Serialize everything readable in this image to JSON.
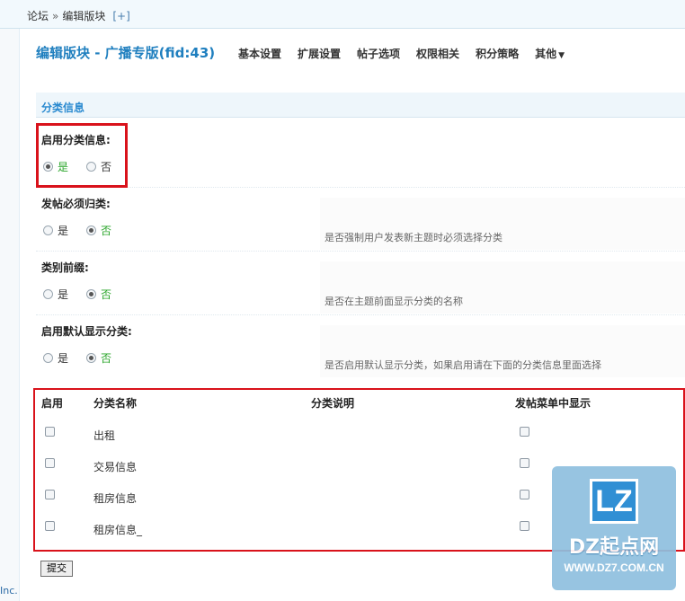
{
  "breadcrumb": {
    "items": [
      "论坛",
      "编辑版块"
    ],
    "separator": "»",
    "add_label": "[+]"
  },
  "header": {
    "title": "编辑版块 - 广播专版(fid:43)",
    "tabs": [
      "基本设置",
      "扩展设置",
      "帖子选项",
      "权限相关",
      "积分策略",
      "其他"
    ]
  },
  "section": {
    "title": "分类信息"
  },
  "settings": [
    {
      "label": "启用分类信息:",
      "options": [
        "是",
        "否"
      ],
      "selected": "是",
      "tip": ""
    },
    {
      "label": "发帖必须归类:",
      "options": [
        "是",
        "否"
      ],
      "selected": "否",
      "tip": "是否强制用户发表新主题时必须选择分类"
    },
    {
      "label": "类别前缀:",
      "options": [
        "是",
        "否"
      ],
      "selected": "否",
      "tip": "是否在主题前面显示分类的名称"
    },
    {
      "label": "启用默认显示分类:",
      "options": [
        "是",
        "否"
      ],
      "selected": "否",
      "tip": "是否启用默认显示分类，如果启用请在下面的分类信息里面选择"
    }
  ],
  "table": {
    "headers": {
      "enable": "启用",
      "name": "分类名称",
      "desc": "分类说明",
      "menu": "发帖菜单中显示"
    },
    "rows": [
      {
        "name": "出租",
        "enabled": false,
        "show_in_menu": false
      },
      {
        "name": "交易信息",
        "enabled": false,
        "show_in_menu": false
      },
      {
        "name": "租房信息",
        "enabled": false,
        "show_in_menu": false
      },
      {
        "name": "租房信息_",
        "enabled": false,
        "show_in_menu": false
      }
    ]
  },
  "submit_label": "提交",
  "footer_fragment": "Inc.",
  "watermark": {
    "logo": "LZ",
    "brand": "DZ起点网",
    "url": "WWW.DZ7.COM.CN"
  },
  "colors": {
    "title": "#1f7fbf",
    "section": "#2a8ad0",
    "selected": "#2aa52a",
    "highlight": "#d9121b"
  }
}
